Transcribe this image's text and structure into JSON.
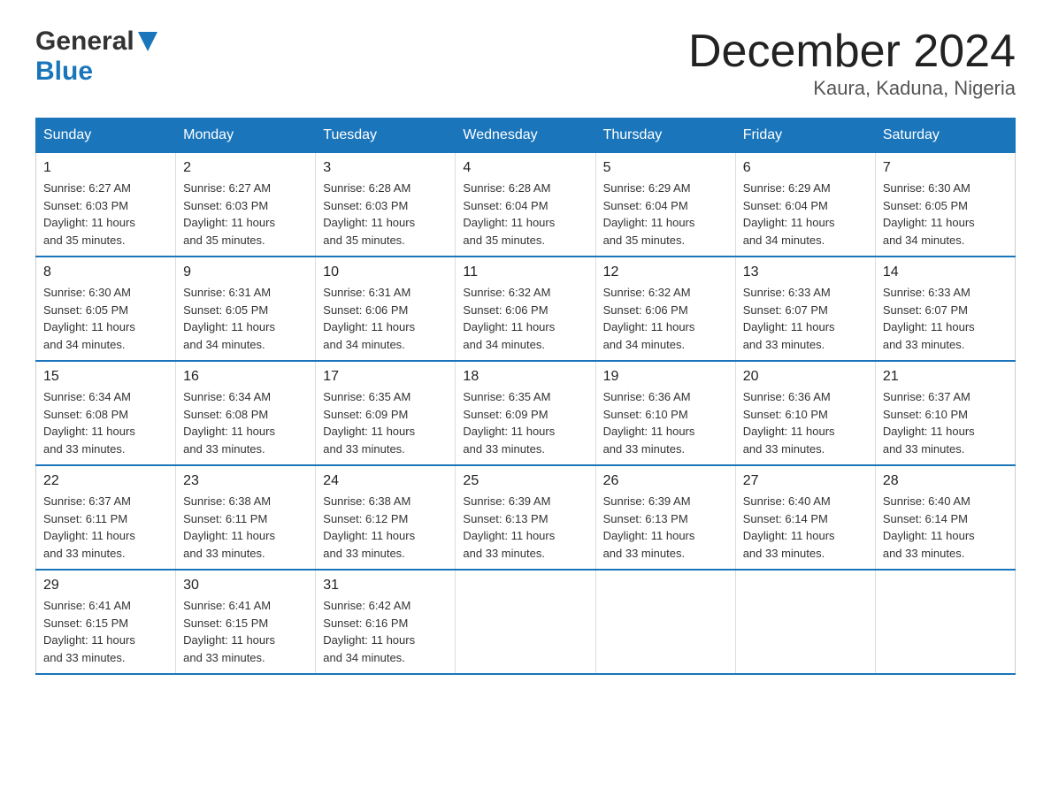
{
  "logo": {
    "general": "General",
    "blue": "Blue"
  },
  "title": "December 2024",
  "subtitle": "Kaura, Kaduna, Nigeria",
  "days_of_week": [
    "Sunday",
    "Monday",
    "Tuesday",
    "Wednesday",
    "Thursday",
    "Friday",
    "Saturday"
  ],
  "weeks": [
    [
      {
        "day": "1",
        "sunrise": "6:27 AM",
        "sunset": "6:03 PM",
        "daylight": "11 hours and 35 minutes."
      },
      {
        "day": "2",
        "sunrise": "6:27 AM",
        "sunset": "6:03 PM",
        "daylight": "11 hours and 35 minutes."
      },
      {
        "day": "3",
        "sunrise": "6:28 AM",
        "sunset": "6:03 PM",
        "daylight": "11 hours and 35 minutes."
      },
      {
        "day": "4",
        "sunrise": "6:28 AM",
        "sunset": "6:04 PM",
        "daylight": "11 hours and 35 minutes."
      },
      {
        "day": "5",
        "sunrise": "6:29 AM",
        "sunset": "6:04 PM",
        "daylight": "11 hours and 35 minutes."
      },
      {
        "day": "6",
        "sunrise": "6:29 AM",
        "sunset": "6:04 PM",
        "daylight": "11 hours and 34 minutes."
      },
      {
        "day": "7",
        "sunrise": "6:30 AM",
        "sunset": "6:05 PM",
        "daylight": "11 hours and 34 minutes."
      }
    ],
    [
      {
        "day": "8",
        "sunrise": "6:30 AM",
        "sunset": "6:05 PM",
        "daylight": "11 hours and 34 minutes."
      },
      {
        "day": "9",
        "sunrise": "6:31 AM",
        "sunset": "6:05 PM",
        "daylight": "11 hours and 34 minutes."
      },
      {
        "day": "10",
        "sunrise": "6:31 AM",
        "sunset": "6:06 PM",
        "daylight": "11 hours and 34 minutes."
      },
      {
        "day": "11",
        "sunrise": "6:32 AM",
        "sunset": "6:06 PM",
        "daylight": "11 hours and 34 minutes."
      },
      {
        "day": "12",
        "sunrise": "6:32 AM",
        "sunset": "6:06 PM",
        "daylight": "11 hours and 34 minutes."
      },
      {
        "day": "13",
        "sunrise": "6:33 AM",
        "sunset": "6:07 PM",
        "daylight": "11 hours and 33 minutes."
      },
      {
        "day": "14",
        "sunrise": "6:33 AM",
        "sunset": "6:07 PM",
        "daylight": "11 hours and 33 minutes."
      }
    ],
    [
      {
        "day": "15",
        "sunrise": "6:34 AM",
        "sunset": "6:08 PM",
        "daylight": "11 hours and 33 minutes."
      },
      {
        "day": "16",
        "sunrise": "6:34 AM",
        "sunset": "6:08 PM",
        "daylight": "11 hours and 33 minutes."
      },
      {
        "day": "17",
        "sunrise": "6:35 AM",
        "sunset": "6:09 PM",
        "daylight": "11 hours and 33 minutes."
      },
      {
        "day": "18",
        "sunrise": "6:35 AM",
        "sunset": "6:09 PM",
        "daylight": "11 hours and 33 minutes."
      },
      {
        "day": "19",
        "sunrise": "6:36 AM",
        "sunset": "6:10 PM",
        "daylight": "11 hours and 33 minutes."
      },
      {
        "day": "20",
        "sunrise": "6:36 AM",
        "sunset": "6:10 PM",
        "daylight": "11 hours and 33 minutes."
      },
      {
        "day": "21",
        "sunrise": "6:37 AM",
        "sunset": "6:10 PM",
        "daylight": "11 hours and 33 minutes."
      }
    ],
    [
      {
        "day": "22",
        "sunrise": "6:37 AM",
        "sunset": "6:11 PM",
        "daylight": "11 hours and 33 minutes."
      },
      {
        "day": "23",
        "sunrise": "6:38 AM",
        "sunset": "6:11 PM",
        "daylight": "11 hours and 33 minutes."
      },
      {
        "day": "24",
        "sunrise": "6:38 AM",
        "sunset": "6:12 PM",
        "daylight": "11 hours and 33 minutes."
      },
      {
        "day": "25",
        "sunrise": "6:39 AM",
        "sunset": "6:13 PM",
        "daylight": "11 hours and 33 minutes."
      },
      {
        "day": "26",
        "sunrise": "6:39 AM",
        "sunset": "6:13 PM",
        "daylight": "11 hours and 33 minutes."
      },
      {
        "day": "27",
        "sunrise": "6:40 AM",
        "sunset": "6:14 PM",
        "daylight": "11 hours and 33 minutes."
      },
      {
        "day": "28",
        "sunrise": "6:40 AM",
        "sunset": "6:14 PM",
        "daylight": "11 hours and 33 minutes."
      }
    ],
    [
      {
        "day": "29",
        "sunrise": "6:41 AM",
        "sunset": "6:15 PM",
        "daylight": "11 hours and 33 minutes."
      },
      {
        "day": "30",
        "sunrise": "6:41 AM",
        "sunset": "6:15 PM",
        "daylight": "11 hours and 33 minutes."
      },
      {
        "day": "31",
        "sunrise": "6:42 AM",
        "sunset": "6:16 PM",
        "daylight": "11 hours and 34 minutes."
      },
      null,
      null,
      null,
      null
    ]
  ],
  "labels": {
    "sunrise": "Sunrise:",
    "sunset": "Sunset:",
    "daylight": "Daylight:"
  }
}
